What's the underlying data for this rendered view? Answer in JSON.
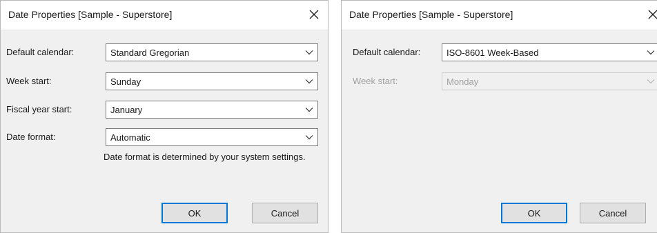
{
  "dialog_left": {
    "title": "Date Properties [Sample - Superstore]",
    "fields": [
      {
        "label": "Default calendar:",
        "value": "Standard Gregorian"
      },
      {
        "label": "Week start:",
        "value": "Sunday"
      },
      {
        "label": "Fiscal year start:",
        "value": "January"
      },
      {
        "label": "Date format:",
        "value": "Automatic"
      }
    ],
    "note": "Date format is determined by your system settings.",
    "ok_label": "OK",
    "cancel_label": "Cancel"
  },
  "dialog_right": {
    "title": "Date Properties [Sample - Superstore]",
    "fields": [
      {
        "label": "Default calendar:",
        "value": "ISO-8601 Week-Based"
      },
      {
        "label": "Week start:",
        "value": "Monday",
        "disabled": true
      }
    ],
    "ok_label": "OK",
    "cancel_label": "Cancel"
  },
  "icons": {
    "close": "close-icon",
    "dropdown": "chevron-down-icon"
  },
  "colors": {
    "dialog_bg": "#f0f0f0",
    "titlebar_bg": "#ffffff",
    "default_button_border": "#0078d7",
    "disabled_text": "#a0a0a0"
  }
}
